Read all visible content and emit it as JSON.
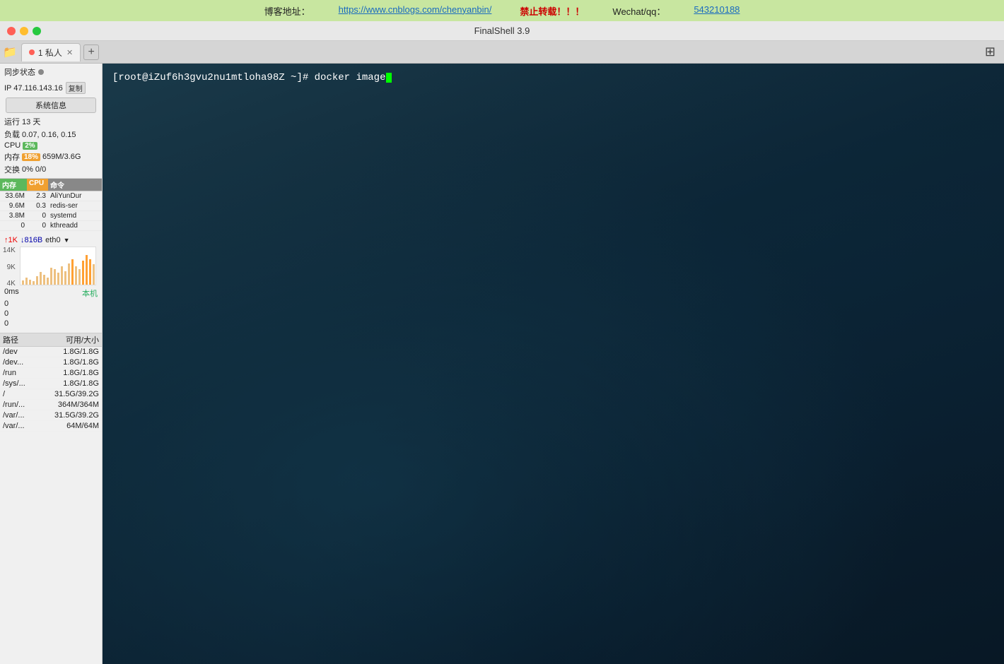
{
  "banner": {
    "prefix": "博客地址：",
    "url": "https://www.cnblogs.com/chenyanbin/",
    "warn": "禁止转载！！！",
    "wechat_label": "Wechat/qq：",
    "wechat_id": "543210188"
  },
  "titlebar": {
    "title": "FinalShell 3.9"
  },
  "tabbar": {
    "tab_label": "1 私人",
    "add_label": "+",
    "grid_icon": "⊞"
  },
  "sidebar": {
    "sync_label": "同步状态",
    "ip_label": "IP 47.116.143.16",
    "copy_label": "复制",
    "sysinfo_label": "系统信息",
    "uptime_label": "运行 13 天",
    "load_label": "负载 0.07, 0.16, 0.15",
    "cpu_label": "CPU",
    "cpu_value": "2%",
    "mem_label": "内存",
    "mem_percent": "18%",
    "mem_value": "659M/3.6G",
    "swap_label": "交换",
    "swap_percent": "0%",
    "swap_value": "0/0",
    "process_headers": {
      "mem": "内存",
      "cpu": "CPU",
      "cmd": "命令"
    },
    "processes": [
      {
        "mem": "33.6M",
        "cpu": "2.3",
        "cmd": "AliYunDur"
      },
      {
        "mem": "9.6M",
        "cpu": "0.3",
        "cmd": "redis-ser"
      },
      {
        "mem": "3.8M",
        "cpu": "0",
        "cmd": "systemd"
      },
      {
        "mem": "0",
        "cpu": "0",
        "cmd": "kthreadd"
      }
    ],
    "net_up": "↑1K",
    "net_down": "↓816B",
    "net_iface": "eth0",
    "net_graph_labels": {
      "y_max": "14K",
      "y_mid": "9K",
      "y_min": "4K"
    },
    "latency_label": "0ms",
    "latency_right": "本机",
    "ping_vals": [
      "0",
      "0",
      "0"
    ],
    "disk_header": {
      "path": "路径",
      "avail": "可用/大小"
    },
    "disks": [
      {
        "path": "/dev",
        "avail": "1.8G/1.8G"
      },
      {
        "path": "/dev...",
        "avail": "1.8G/1.8G"
      },
      {
        "path": "/run",
        "avail": "1.8G/1.8G"
      },
      {
        "path": "/sys/...",
        "avail": "1.8G/1.8G"
      },
      {
        "path": "/",
        "avail": "31.5G/39.2G"
      },
      {
        "path": "/run/...",
        "avail": "364M/364M"
      },
      {
        "path": "/var/...",
        "avail": "31.5G/39.2G"
      },
      {
        "path": "/var/...",
        "avail": "64M/64M"
      }
    ]
  },
  "terminal": {
    "prompt": "[root@iZuf6h3gvu2nu1mtloha98Z ~]#",
    "command": "docker image"
  }
}
